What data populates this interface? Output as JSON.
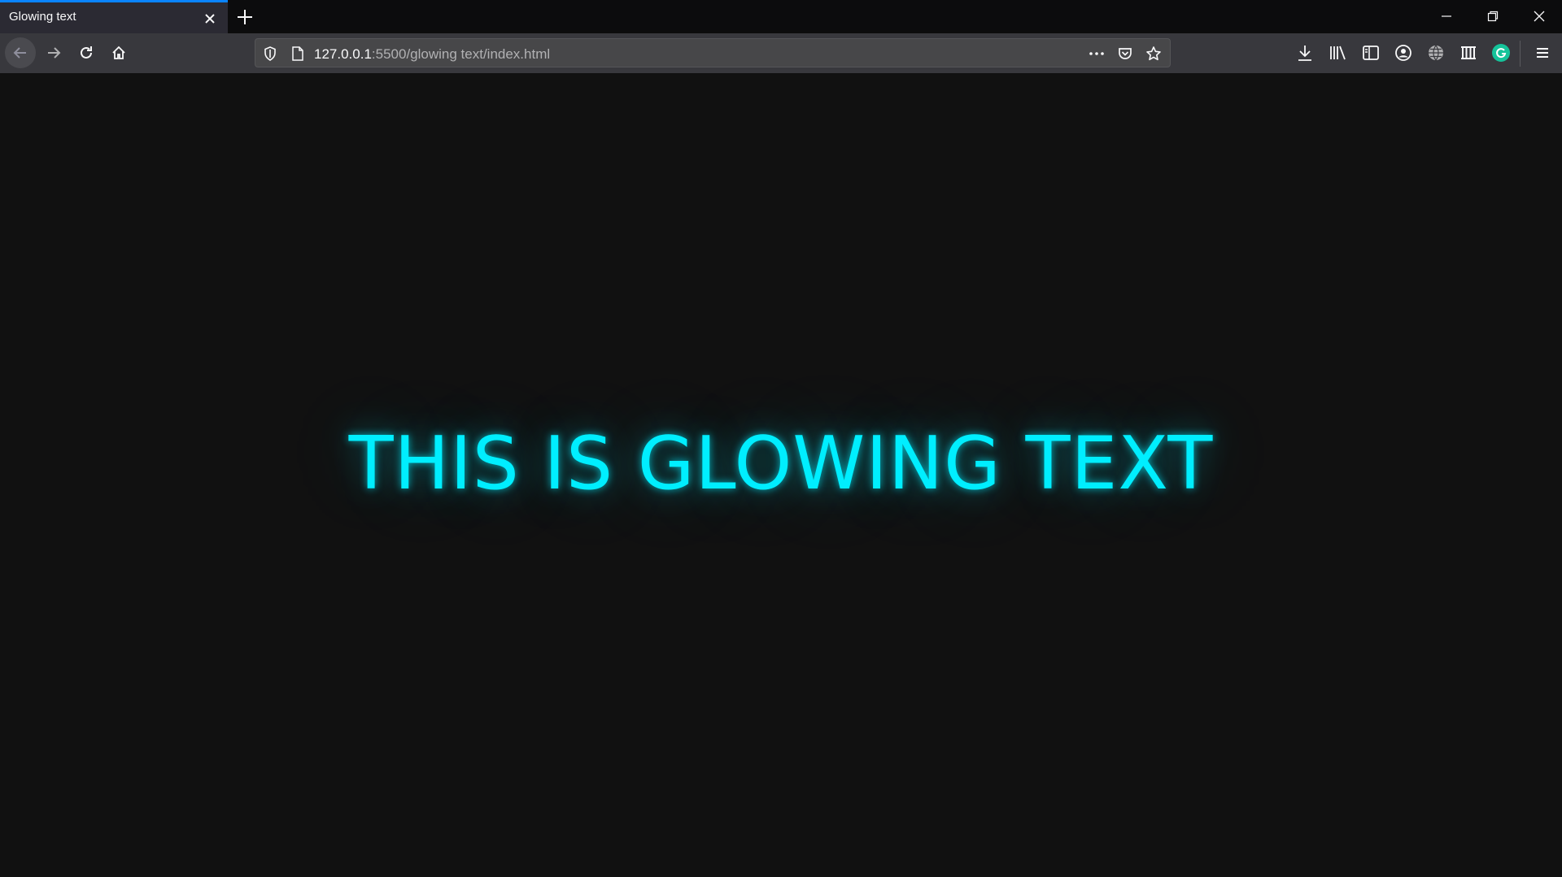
{
  "tab": {
    "title": "Glowing text",
    "close_icon": "close-icon"
  },
  "toolbar": {
    "new_tab_icon": "plus-icon",
    "back_icon": "arrow-left-icon",
    "forward_icon": "arrow-right-icon",
    "reload_icon": "reload-icon",
    "home_icon": "home-icon"
  },
  "urlbar": {
    "host": "127.0.0.1",
    "path": ":5500/glowing text/index.html",
    "shield_icon": "tracking-shield-icon",
    "page_icon": "page-icon",
    "more_icon": "more-dots-icon",
    "pocket_icon": "pocket-icon",
    "bookmark_icon": "star-icon"
  },
  "right_toolbar": {
    "icons": [
      "download-icon",
      "library-icon",
      "sidebar-icon",
      "account-icon",
      "globe-icon",
      "extension-grid-icon",
      "grammarly-icon",
      "hamburger-menu-icon"
    ]
  },
  "window_controls": {
    "icons": [
      "minimize-icon",
      "restore-icon",
      "close-window-icon"
    ]
  },
  "colors": {
    "accent": "#0a84ff",
    "glow": "#00eeff",
    "page_bg": "#111111",
    "grammarly": "#15c39a"
  },
  "page": {
    "heading": "THIS IS GLOWING TEXT"
  }
}
